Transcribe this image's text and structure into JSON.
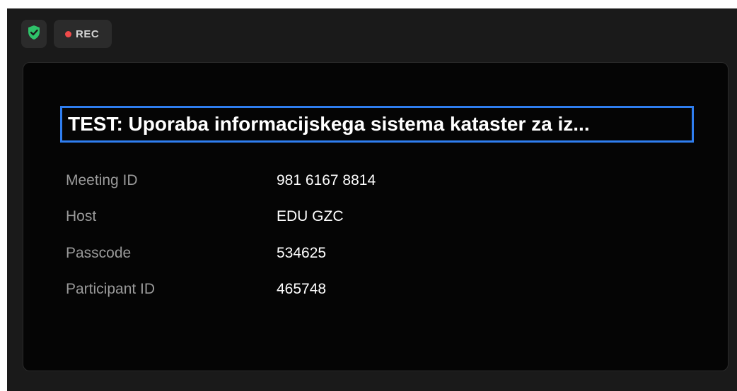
{
  "toolbar": {
    "shield_icon": "shield-check-icon",
    "shield_color": "#2fc36a",
    "rec_label": "REC",
    "rec_dot_color": "#ef4a4a"
  },
  "meeting": {
    "title": "TEST: Uporaba informacijskega sistema kataster za iz...",
    "rows": [
      {
        "label": "Meeting ID",
        "value": "981 6167 8814"
      },
      {
        "label": "Host",
        "value": "EDU GZC"
      },
      {
        "label": "Passcode",
        "value": "534625"
      },
      {
        "label": "Participant ID",
        "value": "465748"
      }
    ]
  },
  "colors": {
    "focus_outline": "#2f7ef0",
    "panel_bg": "#050505",
    "window_bg": "#1a1a1a"
  }
}
